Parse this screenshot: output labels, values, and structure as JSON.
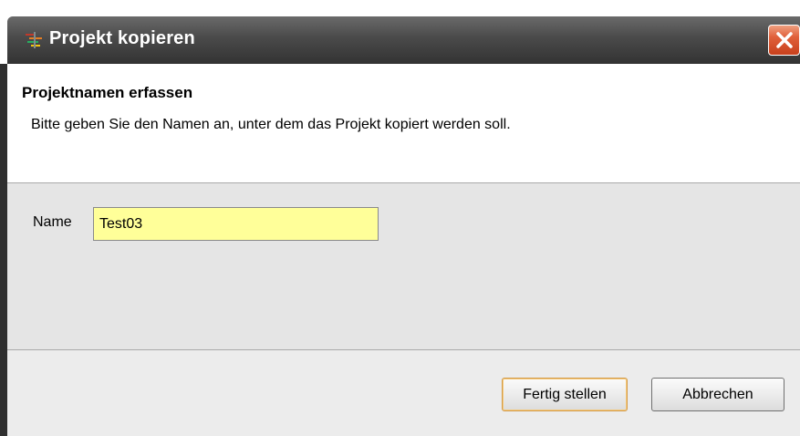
{
  "window": {
    "title": "Projekt kopieren",
    "title_icon": "app-icon",
    "close_icon": "close-icon"
  },
  "header": {
    "title": "Projektnamen erfassen",
    "description": "Bitte geben Sie den Namen an, unter dem das Projekt kopiert werden soll."
  },
  "form": {
    "name_label": "Name",
    "name_value": "Test03"
  },
  "buttons": {
    "finish_label": "Fertig stellen",
    "cancel_label": "Abbrechen"
  },
  "colors": {
    "input_background": "#ffff99",
    "close_button": "#e0603a"
  }
}
